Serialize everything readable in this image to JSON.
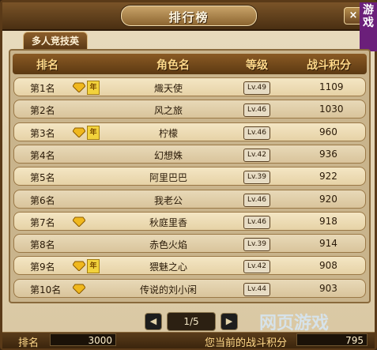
{
  "window": {
    "title": "排行榜",
    "close_label": "×",
    "brand_text": "游戏"
  },
  "tab": {
    "label": "多人竞技英"
  },
  "header": {
    "rank": "排名",
    "name": "角色名",
    "level": "等级",
    "score": "战斗积分"
  },
  "rows": [
    {
      "rank": "第1名",
      "name": "熾天使",
      "level": "Lv.49",
      "score": "1109",
      "gem": true,
      "badge": "年"
    },
    {
      "rank": "第2名",
      "name": "风之旅",
      "level": "Lv.46",
      "score": "1030",
      "gem": false,
      "badge": ""
    },
    {
      "rank": "第3名",
      "name": "柠檬",
      "level": "Lv.46",
      "score": "960",
      "gem": true,
      "badge": "年"
    },
    {
      "rank": "第4名",
      "name": "幻想姝",
      "level": "Lv.42",
      "score": "936",
      "gem": false,
      "badge": ""
    },
    {
      "rank": "第5名",
      "name": "阿里巴巴",
      "level": "Lv.39",
      "score": "922",
      "gem": false,
      "badge": ""
    },
    {
      "rank": "第6名",
      "name": "我老公",
      "level": "Lv.46",
      "score": "920",
      "gem": false,
      "badge": ""
    },
    {
      "rank": "第7名",
      "name": "秋庭里香",
      "level": "Lv.46",
      "score": "918",
      "gem": true,
      "badge": ""
    },
    {
      "rank": "第8名",
      "name": "赤色火焰",
      "level": "Lv.39",
      "score": "914",
      "gem": false,
      "badge": ""
    },
    {
      "rank": "第9名",
      "name": "猥魅之心",
      "level": "Lv.42",
      "score": "908",
      "gem": true,
      "badge": "年"
    },
    {
      "rank": "第10名",
      "name": "传说的刘小闲",
      "level": "Lv.44",
      "score": "903",
      "gem": true,
      "badge": ""
    }
  ],
  "pager": {
    "label": "1/5",
    "prev": "◀",
    "next": "▶"
  },
  "footer": {
    "rank_label": "排名",
    "rank_value": "3000",
    "score_label": "您当前的战斗积分",
    "score_value": "795"
  },
  "watermark": "网页游戏",
  "colors": {
    "gem": "#f0b81e",
    "accent": "#ffd98a"
  }
}
